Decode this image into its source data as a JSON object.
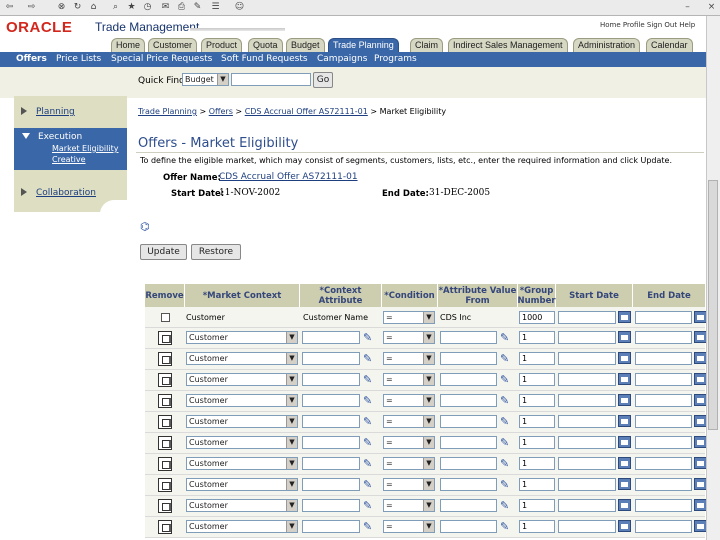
{
  "app": {
    "logo": "ORACLE",
    "name": "Trade Management"
  },
  "global_links": "Home Profile Sign Out Help",
  "tabs": [
    "Home",
    "Customer",
    "Product",
    "Quota",
    "Budget",
    "Trade Planning",
    "Claim",
    "Indirect Sales Management",
    "Administration",
    "Calendar"
  ],
  "active_tab": "Trade Planning",
  "subnav": [
    "Offers",
    "Price Lists",
    "Special Price Requests",
    "Soft Fund Requests",
    "Campaigns",
    "Programs"
  ],
  "quick_find": {
    "label": "Quick Find",
    "select_value": "Budget",
    "input_value": "",
    "go_label": "Go"
  },
  "sidebar": {
    "planning": "Planning",
    "execution": "Execution",
    "execution_sub": [
      "Market Eligibility",
      "Creative"
    ],
    "collaboration": "Collaboration"
  },
  "breadcrumb": [
    "Trade Planning",
    "Offers",
    "CDS Accrual Offer AS72111-01",
    "Market Eligibility"
  ],
  "page_title": "Offers - Market Eligibility",
  "instruction": "To define the eligible market, which may consist of segments, customers, lists, etc., enter the required information and click Update.",
  "offer": {
    "name_label": "Offer Name:",
    "name_value": "CDS Accrual Offer AS72111-01",
    "start_label": "Start Date:",
    "start_value": "11-NOV-2002",
    "end_label": "End Date:",
    "end_value": "31-DEC-2005"
  },
  "buttons": {
    "update": "Update",
    "restore": "Restore"
  },
  "table": {
    "headers": [
      "Remove",
      "*Market Context",
      "*Context Attribute",
      "*Condition",
      "*Attribute Value From",
      "*Group Number",
      "Start Date",
      "End Date"
    ],
    "first_row": {
      "context": "Customer",
      "attribute": "Customer Name",
      "condition": "=",
      "value_from": "CDS Inc",
      "group": "1000",
      "start": "",
      "end": ""
    },
    "empty_rows": [
      {
        "context": "Customer",
        "condition": "=",
        "group": "1"
      },
      {
        "context": "Customer",
        "condition": "=",
        "group": "1"
      },
      {
        "context": "Customer",
        "condition": "=",
        "group": "1"
      },
      {
        "context": "Customer",
        "condition": "=",
        "group": "1"
      },
      {
        "context": "Customer",
        "condition": "=",
        "group": "1"
      },
      {
        "context": "Customer",
        "condition": "=",
        "group": "1"
      },
      {
        "context": "Customer",
        "condition": "=",
        "group": "1"
      },
      {
        "context": "Customer",
        "condition": "=",
        "group": "1"
      },
      {
        "context": "Customer",
        "condition": "=",
        "group": "1"
      },
      {
        "context": "Customer",
        "condition": "=",
        "group": "1"
      }
    ]
  },
  "colors": {
    "accent": "#3a67a8",
    "tab": "#d7d8c4",
    "oracle_red": "#d2271c"
  }
}
